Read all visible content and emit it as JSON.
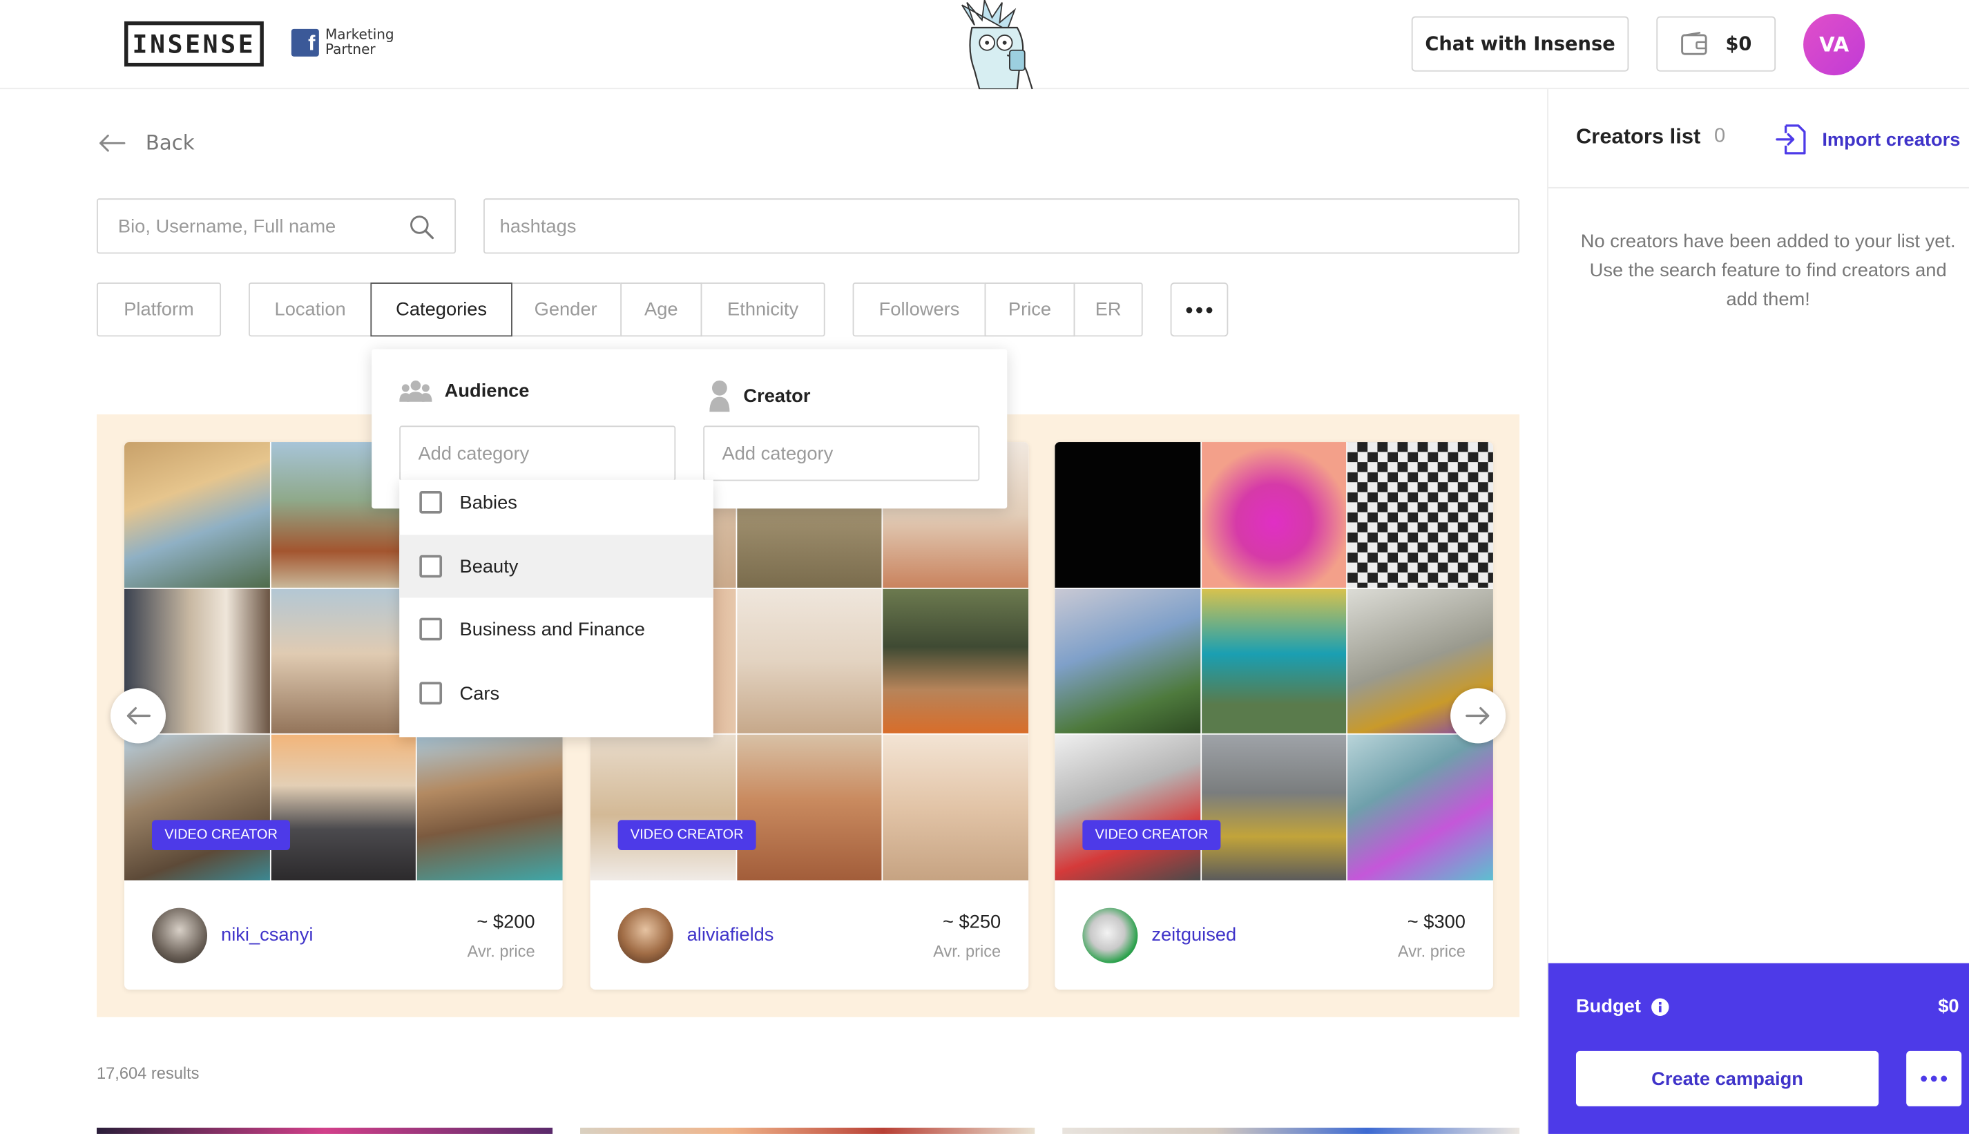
{
  "header": {
    "logo": "INSENSE",
    "partner_line1": "Marketing",
    "partner_line2": "Partner",
    "chat_label": "Chat with Insense",
    "wallet_balance": "$0",
    "avatar_initials": "VA"
  },
  "nav": {
    "back_label": "Back"
  },
  "search": {
    "name_placeholder": "Bio, Username, Full name",
    "hashtags_placeholder": "hashtags"
  },
  "filters": {
    "platform": "Platform",
    "location": "Location",
    "categories": "Categories",
    "gender": "Gender",
    "age": "Age",
    "ethnicity": "Ethnicity",
    "followers": "Followers",
    "price": "Price",
    "er": "ER"
  },
  "categories_popover": {
    "audience_title": "Audience",
    "creator_title": "Creator",
    "audience_placeholder": "Add category",
    "creator_placeholder": "Add category",
    "options": [
      {
        "label": "Babies",
        "checked": false
      },
      {
        "label": "Beauty",
        "checked": false
      },
      {
        "label": "Business and Finance",
        "checked": false
      },
      {
        "label": "Cars",
        "checked": false
      }
    ]
  },
  "creators": [
    {
      "username": "niki_csanyi",
      "badge": "VIDEO CREATOR",
      "price": "~ $200",
      "price_label": "Avr. price"
    },
    {
      "username": "aliviafields",
      "badge": "VIDEO CREATOR",
      "price": "~ $250",
      "price_label": "Avr. price"
    },
    {
      "username": "zeitguised",
      "badge": "VIDEO CREATOR",
      "price": "~ $300",
      "price_label": "Avr. price"
    }
  ],
  "results_text": "17,604 results",
  "sidebar": {
    "title": "Creators list",
    "count": "0",
    "import_label": "Import creators",
    "empty_text": "No creators have been added to your list yet. Use the search feature to find creators and add them!",
    "budget_label": "Budget",
    "budget_value": "$0",
    "create_campaign_label": "Create campaign"
  },
  "colors": {
    "accent": "#4d3ae8",
    "link": "#3f33c9",
    "featured_bg": "#fdf0de",
    "avatar": "#d946c8"
  }
}
